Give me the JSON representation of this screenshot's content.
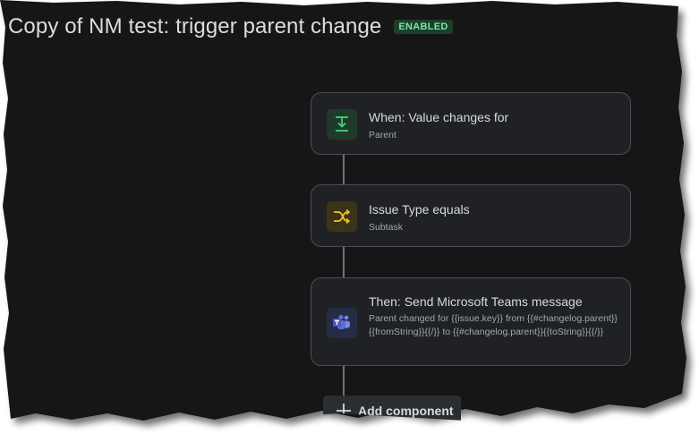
{
  "header": {
    "title": "Copy of NM test: trigger parent change",
    "status": "ENABLED"
  },
  "components": [
    {
      "title": "When: Value changes for",
      "subtitle": "Parent",
      "icon": "download-icon",
      "icon_color": "#3fd27a"
    },
    {
      "title": "Issue Type equals",
      "subtitle": "Subtask",
      "icon": "shuffle-icon",
      "icon_color": "#f2c230"
    },
    {
      "title": "Then: Send Microsoft Teams message",
      "description": "Parent changed for {{issue.key}} from {{#changelog.parent}}{{fromString}}{{/}} to {{#changelog.parent}}{{toString}}{{/}}",
      "icon": "microsoft-teams-icon",
      "icon_color": "#5b6bd8"
    }
  ],
  "footer": {
    "add_label": "Add component"
  },
  "colors": {
    "background": "#161719",
    "card": "#1f2124",
    "badge_bg": "#1c3f2a",
    "badge_text": "#7ee2a8"
  }
}
